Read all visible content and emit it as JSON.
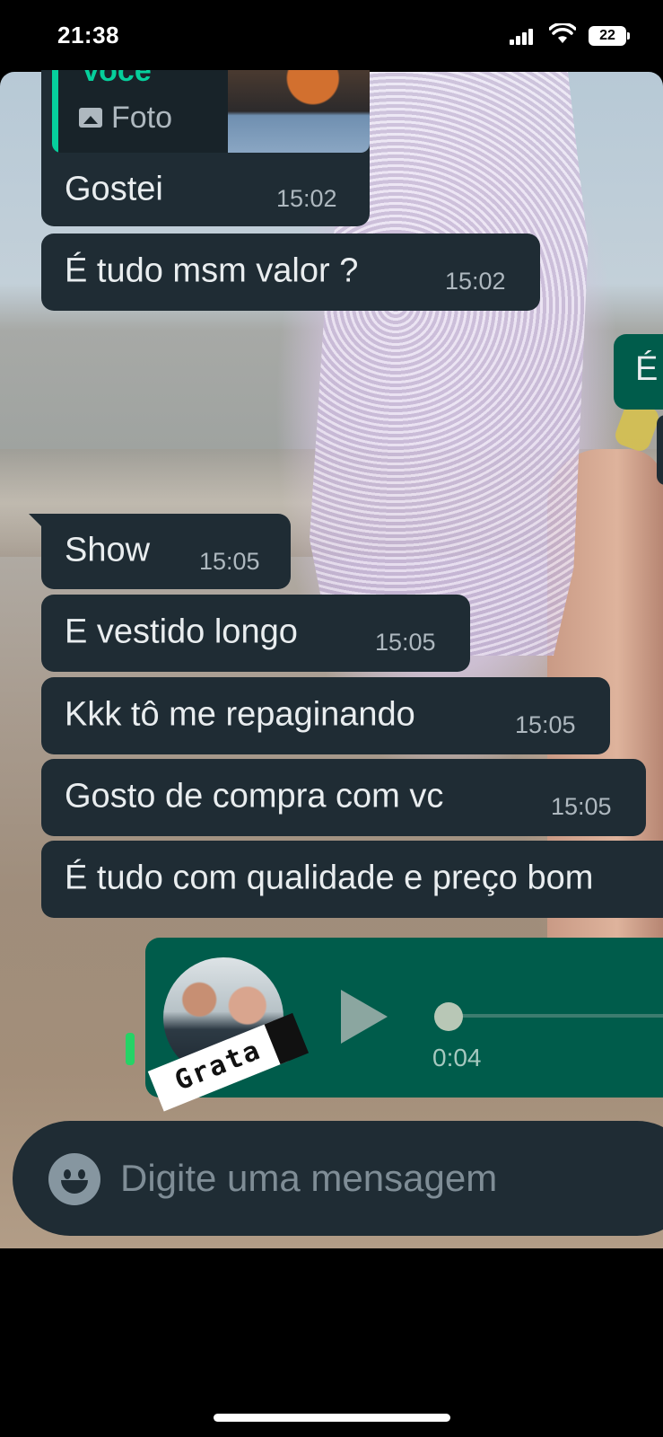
{
  "status_bar": {
    "time": "21:38",
    "battery": "22",
    "icons": [
      "signal-icon",
      "wifi-icon",
      "battery-icon"
    ]
  },
  "chat": {
    "quoted_reply": {
      "author": "Você",
      "media_label": "Foto",
      "icon": "image-icon"
    },
    "messages": [
      {
        "text": "Gostei",
        "time": "15:02",
        "direction": "incoming"
      },
      {
        "text": "É tudo msm valor ?",
        "time": "15:02",
        "direction": "incoming"
      },
      {
        "text": "É",
        "time": "",
        "direction": "outgoing"
      },
      {
        "text": "Show",
        "time": "15:05",
        "direction": "incoming"
      },
      {
        "text": "E vestido longo",
        "time": "15:05",
        "direction": "incoming"
      },
      {
        "text": "Kkk tô me repaginando",
        "time": "15:05",
        "direction": "incoming"
      },
      {
        "text": "Gosto de compra com vc",
        "time": "15:05",
        "direction": "incoming"
      },
      {
        "text": "É tudo com qualidade e preço bom",
        "time": "",
        "direction": "incoming"
      }
    ],
    "voice_message": {
      "duration": "0:04",
      "icons": [
        "avatar",
        "play-icon",
        "microphone-icon"
      ]
    }
  },
  "sticker": {
    "text": "Grata"
  },
  "composer": {
    "placeholder": "Digite uma mensagem",
    "icon": "emoji-icon"
  },
  "colors": {
    "incoming_bubble": "#1f2c34",
    "outgoing_bubble": "#005c4b",
    "accent_green": "#06cf9c"
  }
}
